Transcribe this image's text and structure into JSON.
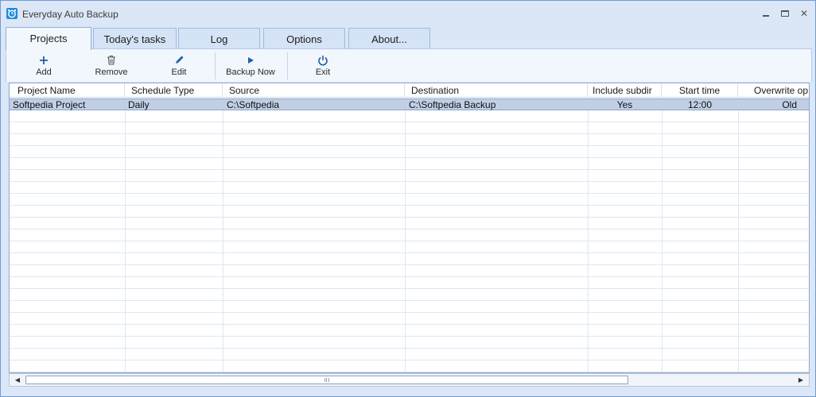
{
  "window": {
    "title": "Everyday Auto Backup",
    "controls": {
      "minimize": "—",
      "maximize": "□",
      "close": "✕"
    }
  },
  "tabs": [
    {
      "label": "Projects",
      "active": true
    },
    {
      "label": "Today's tasks"
    },
    {
      "label": "Log"
    },
    {
      "label": "Options"
    },
    {
      "label": "About..."
    }
  ],
  "toolbar": {
    "add_label": "Add",
    "remove_label": "Remove",
    "edit_label": "Edit",
    "backup_now_label": "Backup Now",
    "exit_label": "Exit"
  },
  "grid": {
    "columns": [
      "Project Name",
      "Schedule Type",
      "Source",
      "Destination",
      "Include subdir",
      "Start time",
      "Overwrite op"
    ],
    "rows": [
      {
        "project_name": "Softpedia Project",
        "schedule_type": "Daily",
        "source": "C:\\Softpedia",
        "destination": "C:\\Softpedia Backup",
        "include_subdir": "Yes",
        "start_time": "12:00",
        "overwrite": "Old"
      }
    ]
  },
  "scrollbar": {
    "left_arrow": "◀",
    "right_arrow": "▶"
  },
  "colors": {
    "window_bg": "#dbe7f6",
    "accent": "#1b8be0",
    "selected_row": "#c1cfe4"
  }
}
